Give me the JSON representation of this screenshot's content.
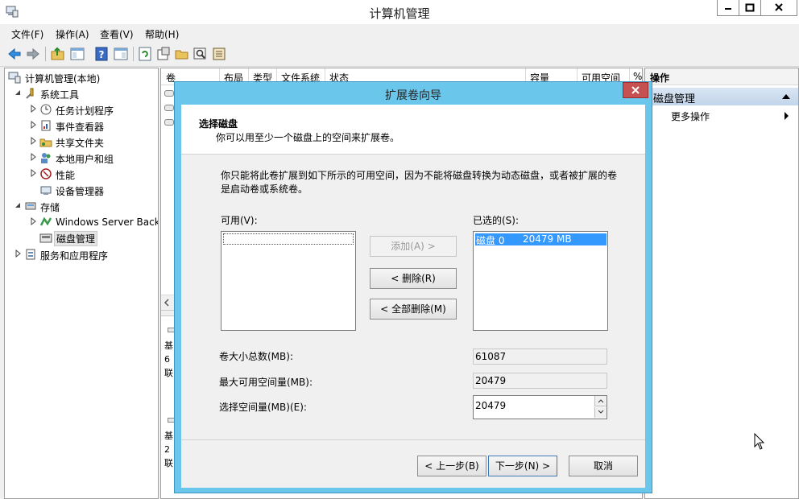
{
  "window": {
    "title": "计算机管理"
  },
  "menu": [
    "文件(F)",
    "操作(A)",
    "查看(V)",
    "帮助(H)"
  ],
  "toolbar": {
    "icons": [
      "back-arrow-icon",
      "forward-arrow-icon",
      "up-folder-icon",
      "show-tree-icon",
      "help-icon",
      "show-action-pane-icon",
      "refresh-icon",
      "properties-icon",
      "open-folder-icon",
      "search-icon",
      "settings-icon"
    ]
  },
  "tree": {
    "root": "计算机管理(本地)",
    "system_tools": "系统工具",
    "task_scheduler": "任务计划程序",
    "event_viewer": "事件查看器",
    "shared_folders": "共享文件夹",
    "local_users": "本地用户和组",
    "performance": "性能",
    "device_manager": "设备管理器",
    "storage": "存储",
    "windows_backup": "Windows Server Backup",
    "disk_management": "磁盘管理",
    "services": "服务和应用程序"
  },
  "center": {
    "columns": [
      "卷",
      "布局",
      "类型",
      "文件系统",
      "状态",
      "容量",
      "可用空间",
      "%"
    ],
    "disk_labels_top": [
      "基",
      "6",
      "联"
    ],
    "disk_labels_bottom": [
      "基",
      "2",
      "联"
    ]
  },
  "actions": {
    "header": "操作",
    "section": "磁盘管理",
    "more": "更多操作"
  },
  "dialog": {
    "title": "扩展卷向导",
    "head_title": "选择磁盘",
    "head_subtitle": "你可以用至少一个磁盘上的空间来扩展卷。",
    "description": "你只能将此卷扩展到如下所示的可用空间，因为不能将磁盘转换为动态磁盘，或者被扩展的卷是启动卷或系统卷。",
    "available_label": "可用(V):",
    "selected_label": "已选的(S):",
    "selected_disk": "磁盘 0",
    "selected_size": "20479 MB",
    "add_button": "添加(A) >",
    "remove_button": "< 删除(R)",
    "remove_all_button": "< 全部删除(M)",
    "total_label": "卷大小总数(MB):",
    "total_value": "61087",
    "max_label": "最大可用空间量(MB):",
    "max_value": "20479",
    "select_label": "选择空间量(MB)(E):",
    "select_value": "20479",
    "back_button": "< 上一步(B)",
    "next_button": "下一步(N) >",
    "cancel_button": "取消"
  }
}
